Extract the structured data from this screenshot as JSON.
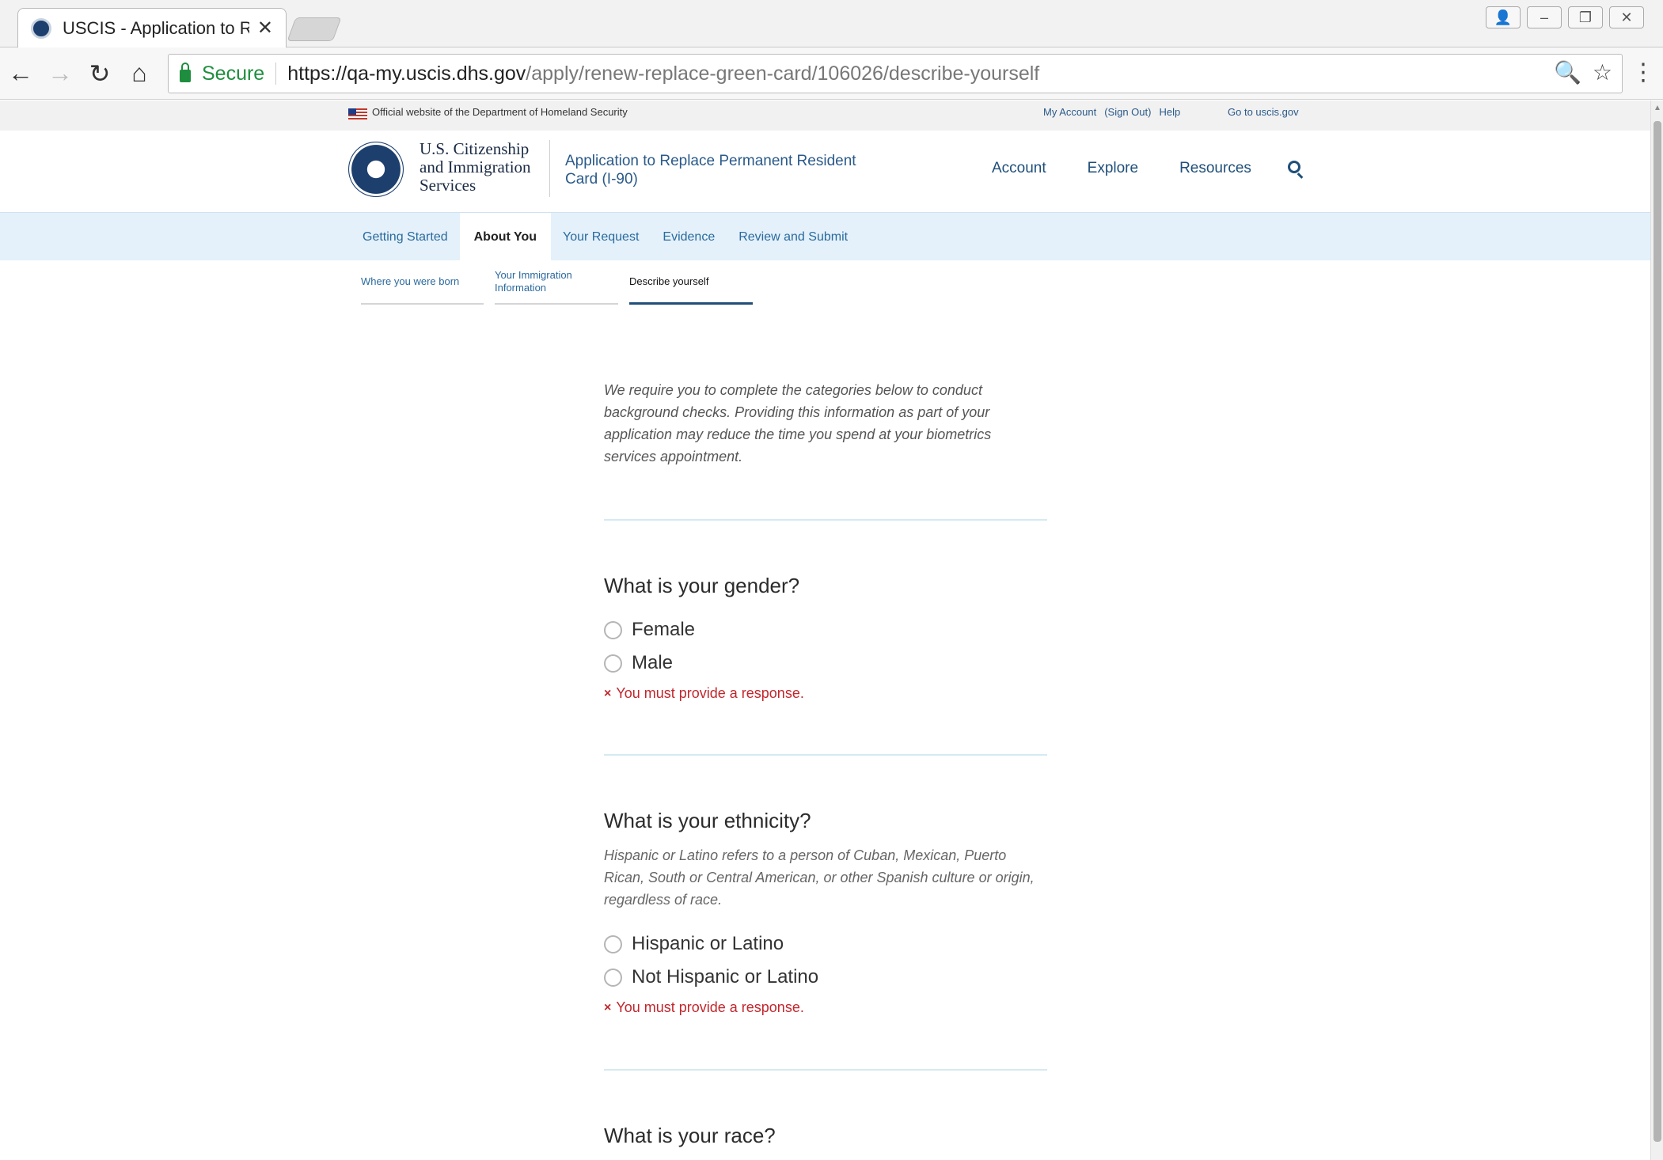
{
  "browser": {
    "tab_title": "USCIS - Application to Re",
    "secure_label": "Secure",
    "url_host": "https://qa-my.uscis.dhs.gov",
    "url_path": "/apply/renew-replace-green-card/106026/describe-yourself"
  },
  "gov_banner": {
    "official_text": "Official website of the Department of Homeland Security",
    "my_account": "My Account",
    "sign_out": "(Sign Out)",
    "help": "Help",
    "goto": "Go to uscis.gov"
  },
  "header": {
    "agency_line1": "U.S. Citizenship",
    "agency_line2": "and Immigration",
    "agency_line3": "Services",
    "app_title": "Application to Replace Permanent Resident Card (I-90)",
    "nav": [
      "Account",
      "Explore",
      "Resources"
    ]
  },
  "steps": [
    "Getting Started",
    "About You",
    "Your Request",
    "Evidence",
    "Review and Submit"
  ],
  "substeps": [
    "Where you were born",
    "Your Immigration Information",
    "Describe yourself"
  ],
  "form": {
    "intro": "We require you to complete the categories below to conduct background checks. Providing this information as part of your application may reduce the time you spend at your biometrics services appointment.",
    "gender": {
      "question": "What is your gender?",
      "options": [
        "Female",
        "Male"
      ],
      "error": "You must provide a response."
    },
    "ethnicity": {
      "question": "What is your ethnicity?",
      "hint": "Hispanic or Latino refers to a person of Cuban, Mexican, Puerto Rican, South or Central American, or other Spanish culture or origin, regardless of race.",
      "options": [
        "Hispanic or Latino",
        "Not Hispanic or Latino"
      ],
      "error": "You must provide a response."
    },
    "race": {
      "question": "What is your race?"
    }
  }
}
